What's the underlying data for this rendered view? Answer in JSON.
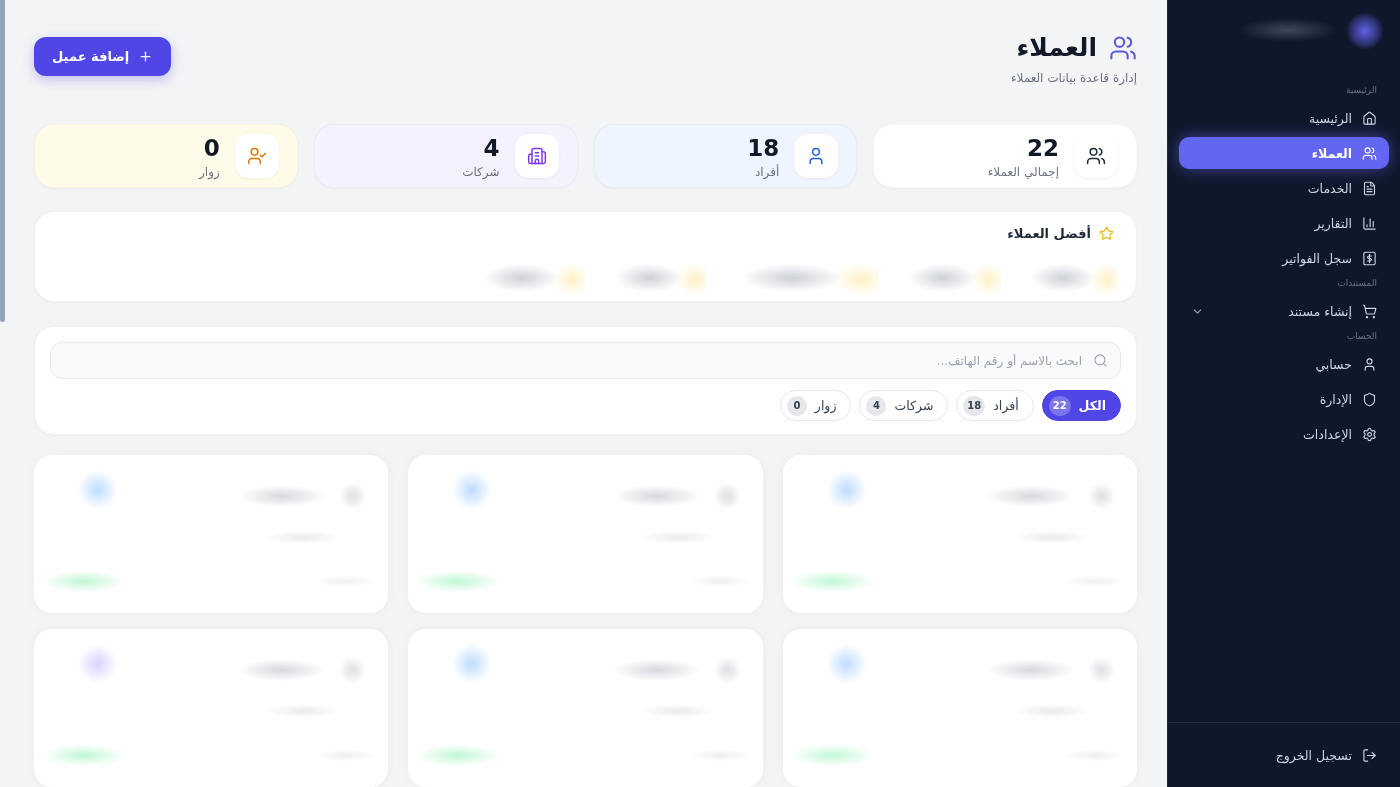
{
  "sidebar": {
    "sections": [
      {
        "label": "الرئيسية",
        "items": [
          {
            "label": "الرئيسية",
            "kind": "link",
            "selected": false
          },
          {
            "label": "العملاء",
            "kind": "link",
            "selected": true
          },
          {
            "label": "الخدمات",
            "kind": "link",
            "selected": false
          },
          {
            "label": "التقارير",
            "kind": "link",
            "selected": false
          },
          {
            "label": "سجل الفواتير",
            "kind": "link",
            "selected": false
          }
        ]
      },
      {
        "label": "المستندات",
        "items": [
          {
            "label": "إنشاء مستند",
            "kind": "submenu",
            "expanded": false,
            "selected": false
          }
        ]
      },
      {
        "label": "الحساب",
        "items": [
          {
            "label": "حسابي",
            "kind": "link",
            "selected": false
          },
          {
            "label": "الإدارة",
            "kind": "link",
            "selected": false
          },
          {
            "label": "الإعدادات",
            "kind": "link",
            "selected": false
          }
        ]
      }
    ],
    "logout": {
      "label": "تسجيل الخروج"
    }
  },
  "header": {
    "title": "العملاء",
    "subtitle": "إدارة قاعدة بيانات العملاء",
    "add_button": "إضافة عميل"
  },
  "stats": [
    {
      "value": "22",
      "label": "إجمالي العملاء"
    },
    {
      "value": "18",
      "label": "أفراد"
    },
    {
      "value": "4",
      "label": "شركات"
    },
    {
      "value": "0",
      "label": "زوار"
    }
  ],
  "top_customers": {
    "title": "أفضل العملاء"
  },
  "search": {
    "placeholder": "ابحث بالاسم أو رقم الهاتف..."
  },
  "filters": [
    {
      "label": "الكل",
      "count": "22",
      "selected": true
    },
    {
      "label": "أفراد",
      "count": "18",
      "selected": false
    },
    {
      "label": "شركات",
      "count": "4",
      "selected": false
    },
    {
      "label": "زوار",
      "count": "0",
      "selected": false
    }
  ]
}
